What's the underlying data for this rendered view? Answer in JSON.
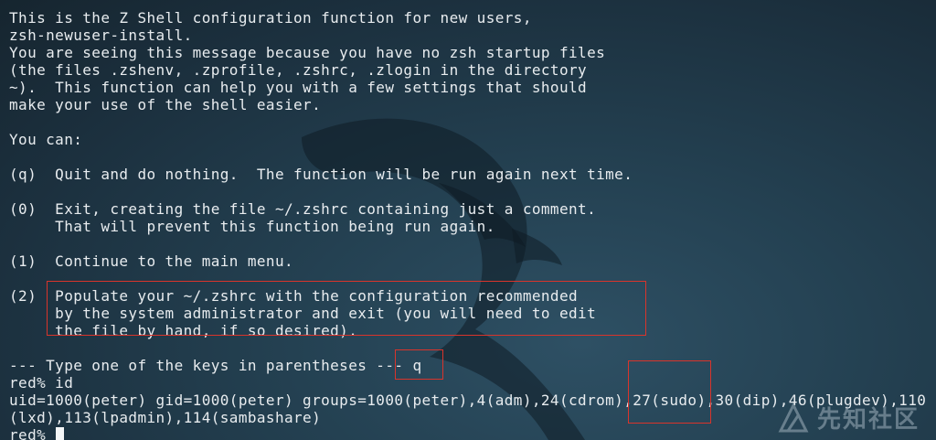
{
  "terminal": {
    "lines": [
      "This is the Z Shell configuration function for new users,",
      "zsh-newuser-install.",
      "You are seeing this message because you have no zsh startup files",
      "(the files .zshenv, .zprofile, .zshrc, .zlogin in the directory",
      "~).  This function can help you with a few settings that should",
      "make your use of the shell easier.",
      "",
      "You can:",
      "",
      "(q)  Quit and do nothing.  The function will be run again next time.",
      "",
      "(0)  Exit, creating the file ~/.zshrc containing just a comment.",
      "     That will prevent this function being run again.",
      "",
      "(1)  Continue to the main menu.",
      "",
      "(2)  Populate your ~/.zshrc with the configuration recommended",
      "     by the system administrator and exit (you will need to edit",
      "     the file by hand, if so desired).",
      "",
      "--- Type one of the keys in parentheses --- q",
      "red% id",
      "uid=1000(peter) gid=1000(peter) groups=1000(peter),4(adm),24(cdrom),27(sudo),30(dip),46(plugdev),110",
      "(lxd),113(lpadmin),114(sambashare)"
    ],
    "prompt": "red% "
  },
  "watermark": {
    "text": "先知社区"
  },
  "colors": {
    "highlight_border": "#d9342b",
    "text": "#e8ecef"
  }
}
